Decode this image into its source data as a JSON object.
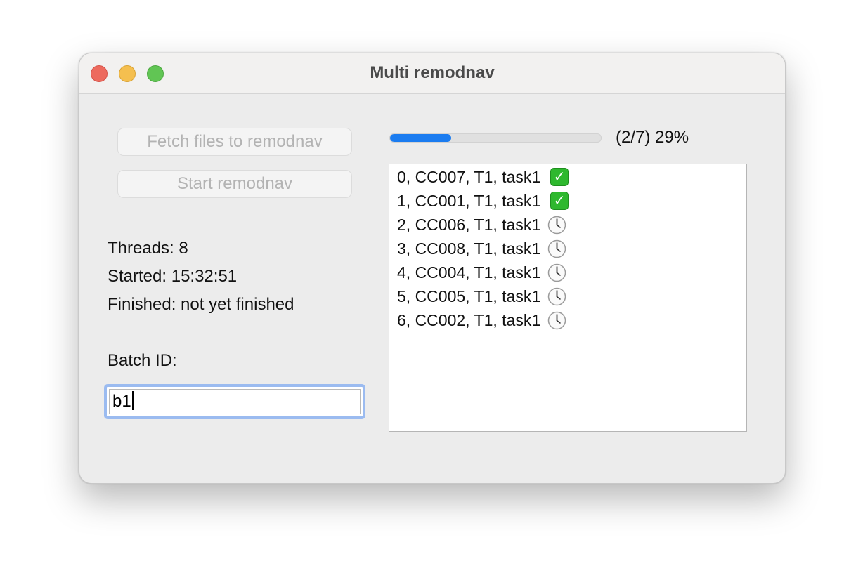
{
  "window": {
    "title": "Multi remodnav"
  },
  "buttons": {
    "fetch_label": "Fetch files to remodnav",
    "start_label": "Start remodnav"
  },
  "info": {
    "threads": "Threads: 8",
    "started": "Started: 15:32:51",
    "finished": "Finished: not yet finished",
    "batch_label": "Batch ID:",
    "batch_value": "b1"
  },
  "progress": {
    "fraction": 0.29,
    "text": "(2/7) 29%"
  },
  "jobs": [
    {
      "label": "0, CC007, T1, task1",
      "status": "done",
      "icon": "check-mark-icon"
    },
    {
      "label": "1, CC001, T1, task1",
      "status": "done",
      "icon": "check-mark-icon"
    },
    {
      "label": "2, CC006, T1, task1",
      "status": "pending",
      "icon": "clock-icon"
    },
    {
      "label": "3, CC008, T1, task1",
      "status": "pending",
      "icon": "clock-icon"
    },
    {
      "label": "4, CC004, T1, task1",
      "status": "pending",
      "icon": "clock-icon"
    },
    {
      "label": "5, CC005, T1, task1",
      "status": "pending",
      "icon": "clock-icon"
    },
    {
      "label": "6, CC002, T1, task1",
      "status": "pending",
      "icon": "clock-icon"
    }
  ],
  "colors": {
    "accent": "#1b7cf0",
    "done": "#2eb82e",
    "focus_ring": "#9bbbf0"
  }
}
